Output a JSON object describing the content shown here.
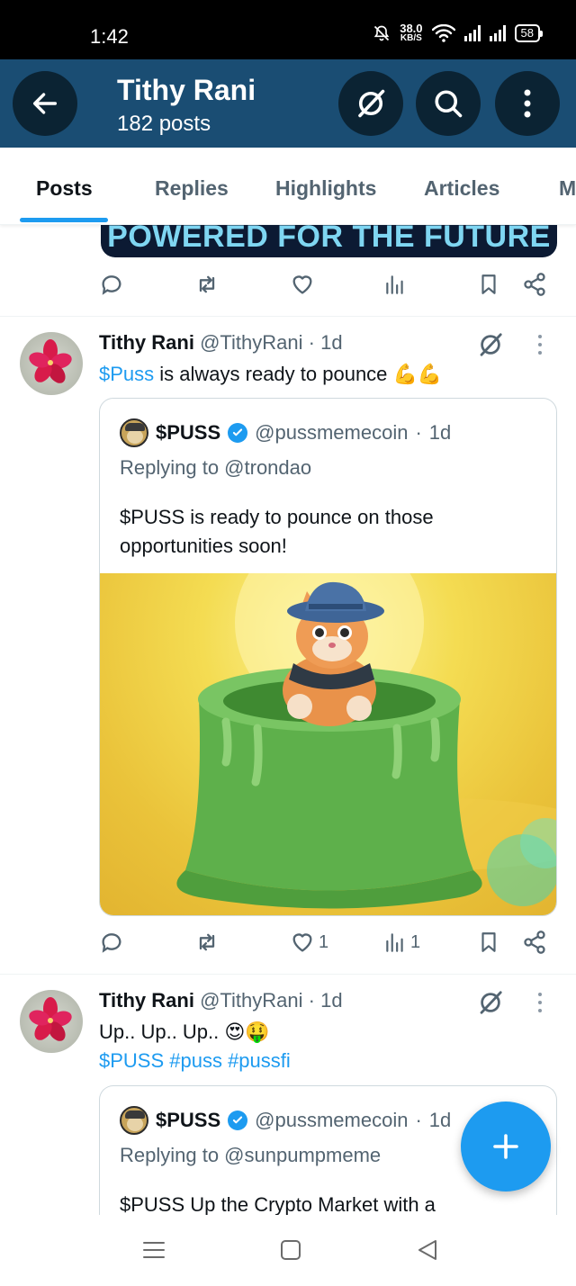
{
  "status_bar": {
    "time": "1:42",
    "speed_value": "38.0",
    "speed_unit": "KB/S",
    "battery": "58"
  },
  "header": {
    "title": "Tithy Rani",
    "subtitle": "182 posts",
    "icons": [
      "back-arrow-icon",
      "grok-icon",
      "search-icon",
      "more-vertical-icon"
    ]
  },
  "tabs": [
    {
      "label": "Posts",
      "active": true
    },
    {
      "label": "Replies"
    },
    {
      "label": "Highlights"
    },
    {
      "label": "Articles"
    },
    {
      "label": "M"
    }
  ],
  "previous_post": {
    "banner_text": "POWERED FOR THE FUTURE"
  },
  "posts": [
    {
      "author": "Tithy Rani",
      "handle": "@TithyRani",
      "time": "1d",
      "text_link": "$Puss",
      "text": " is always ready to pounce ",
      "emoji": "💪💪",
      "quote": {
        "author": "$PUSS",
        "handle": "@pussmemecoin",
        "time": "1d",
        "replying_to": "Replying to @trondao",
        "text": "$PUSS is ready to pounce on those opportunities soon!"
      },
      "likes": "1",
      "views": "1"
    },
    {
      "author": "Tithy Rani",
      "handle": "@TithyRani",
      "time": "1d",
      "text_line1": "Up.. Up.. Up.. ",
      "emoji": "😍🤑",
      "hashtags": "$PUSS #puss #pussfi",
      "quote": {
        "author": "$PUSS",
        "handle": "@pussmemecoin",
        "time": "1d",
        "replying_to": "Replying to @sunpumpmeme",
        "text": "$PUSS Up the Crypto Market with a"
      }
    }
  ],
  "colors": {
    "accent": "#1d9bf0",
    "header_bg": "#1a4d73",
    "text_muted": "#536471"
  }
}
